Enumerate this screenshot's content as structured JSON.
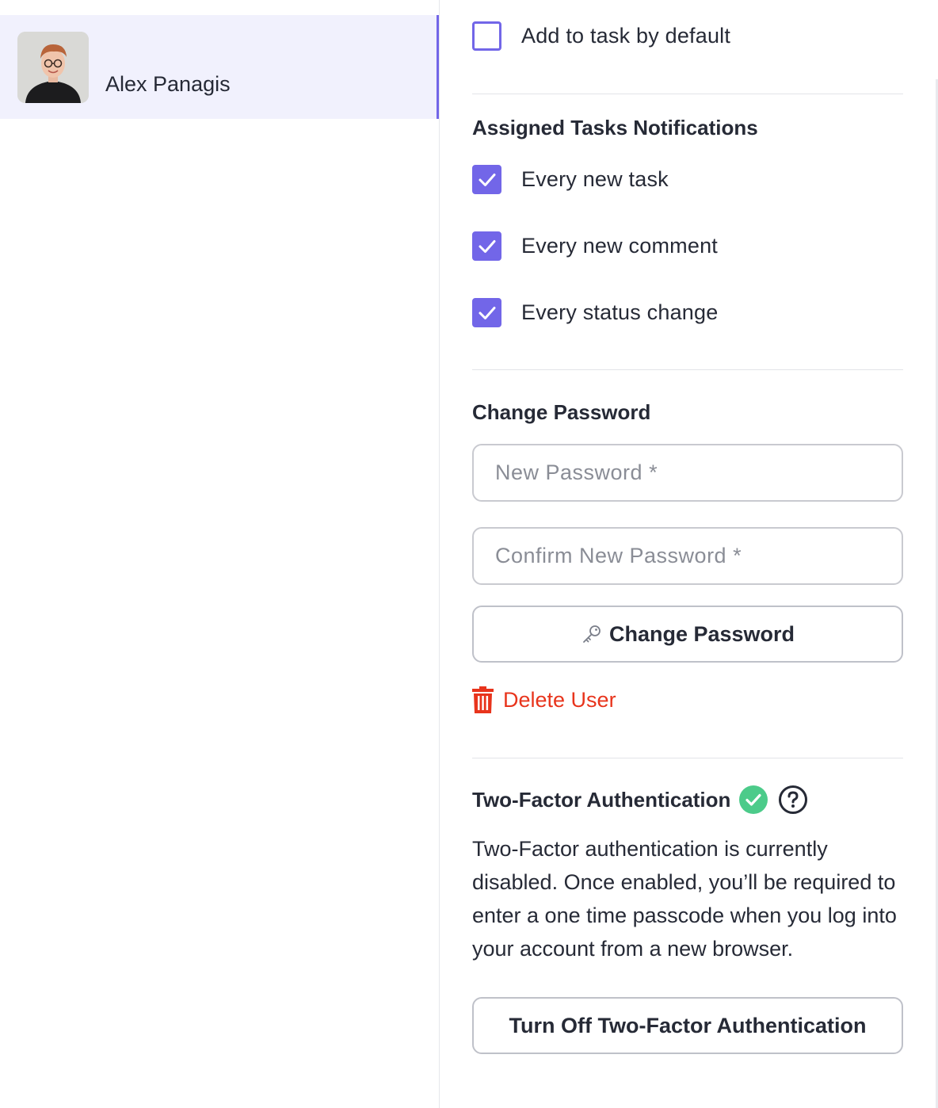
{
  "user": {
    "name": "Alex Panagis"
  },
  "settings": {
    "add_to_task_label": "Add to task by default",
    "add_to_task_checked": false
  },
  "assigned_notifications": {
    "title": "Assigned Tasks Notifications",
    "items": [
      {
        "label": "Every new task",
        "checked": true
      },
      {
        "label": "Every new comment",
        "checked": true
      },
      {
        "label": "Every status change",
        "checked": true
      }
    ]
  },
  "change_password": {
    "title": "Change Password",
    "new_password_placeholder": "New Password *",
    "confirm_password_placeholder": "Confirm New Password *",
    "button_label": "Change Password"
  },
  "delete_user": {
    "label": "Delete User"
  },
  "two_factor": {
    "title": "Two-Factor Authentication",
    "description": "Two-Factor authentication is currently disabled. Once enabled, you’ll be required to enter a one time passcode when you log into your account from a new browser.",
    "button_label": "Turn Off Two-Factor Authentication"
  },
  "colors": {
    "accent": "#7266e8",
    "danger": "#e8341c",
    "success": "#4ccb8a",
    "selected_bg": "#f1f1fd"
  },
  "icons": {
    "avatar": "user-photo",
    "key": "key-icon",
    "trash": "trash-icon",
    "check": "check-circle-icon",
    "help": "question-circle-icon"
  }
}
